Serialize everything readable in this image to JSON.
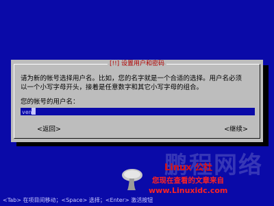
{
  "dialog": {
    "title": "[!!] 设置用户和密码",
    "description_lines": [
      "请为新的帐号选择用户名。比如，您的名字就是一个合适的选择。用户名必须",
      "以一个小写字母开头，接着是任意数字和其它小写字母的组合。"
    ],
    "field_label": "您的帐号的用户名：",
    "username_value": "ven",
    "back_button": "<返回>",
    "continue_button": "<继续>"
  },
  "footer": {
    "hint": "<Tab> 在项目间移动；<Space> 选择；<Enter> 激活按钮"
  },
  "watermark": {
    "brand": "Linux 公社",
    "big_text": "鹏程网络",
    "line1": "您现在查看的文章来自",
    "url": "www.Linuxidc.com"
  },
  "colors": {
    "background": "#0a0aa8",
    "dialog": "#bdbdbd",
    "title": "#b00000",
    "watermark_red": "#e01010"
  }
}
